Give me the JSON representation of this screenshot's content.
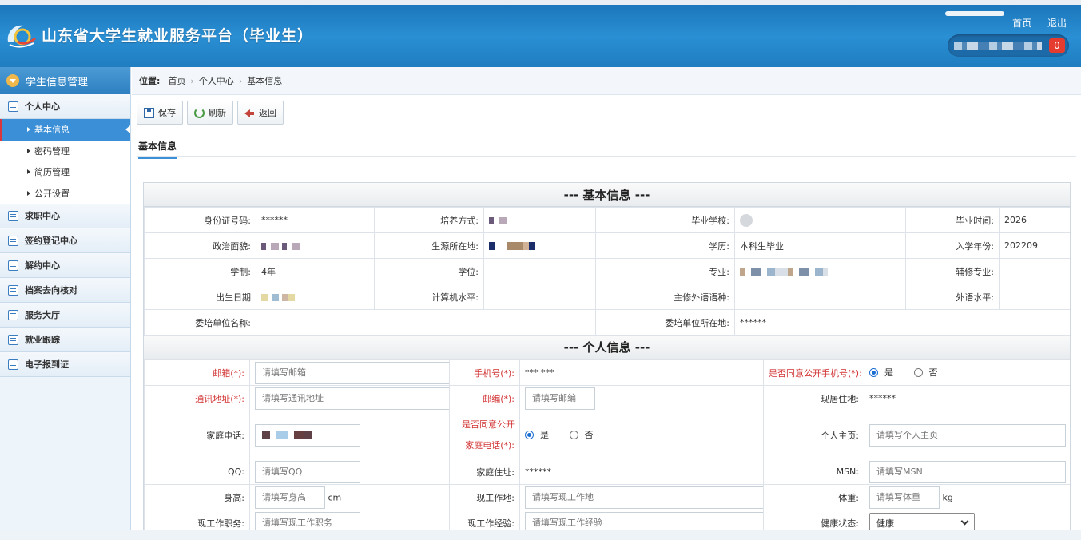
{
  "header": {
    "title": "山东省大学生就业服务平台（毕业生）",
    "home_link": "首页",
    "logout_link": "退出",
    "notification_count": "0"
  },
  "sidebar": {
    "header": "学生信息管理",
    "groups": [
      {
        "label": "个人中心"
      },
      {
        "label": "求职中心"
      },
      {
        "label": "签约登记中心"
      },
      {
        "label": "解约中心"
      },
      {
        "label": "档案去向核对"
      },
      {
        "label": "服务大厅"
      },
      {
        "label": "就业跟踪"
      },
      {
        "label": "电子报到证"
      }
    ],
    "sub_items": [
      {
        "label": "基本信息"
      },
      {
        "label": "密码管理"
      },
      {
        "label": "简历管理"
      },
      {
        "label": "公开设置"
      }
    ]
  },
  "breadcrumb": {
    "label": "位置:",
    "items": [
      "首页",
      "个人中心",
      "基本信息"
    ]
  },
  "toolbar": {
    "save": "保存",
    "refresh": "刷新",
    "back": "返回"
  },
  "tab": "基本信息",
  "basic": {
    "title": "--- 基本信息 ---",
    "id_label": "身份证号码:",
    "id_value": "******",
    "train_label": "培养方式:",
    "school_label": "毕业学校:",
    "grad_time_label": "毕业时间:",
    "grad_time_value": "2026",
    "political_label": "政治面貌:",
    "origin_label": "生源所在地:",
    "edu_label": "学历:",
    "edu_value": "本科生毕业",
    "enroll_label": "入学年份:",
    "enroll_value": "202209",
    "length_label": "学制:",
    "length_value": "4年",
    "degree_label": "学位:",
    "major_label": "专业:",
    "minor_label": "辅修专业:",
    "birth_label": "出生日期",
    "computer_label": "计算机水平:",
    "language_label": "主修外语语种:",
    "language_level_label": "外语水平:",
    "entrust_name_label": "委培单位名称:",
    "entrust_loc_label": "委培单位所在地:",
    "entrust_loc_value": "******"
  },
  "personal": {
    "title": "--- 个人信息 ---",
    "email_label": "邮箱(*):",
    "email_placeholder": "请填写邮箱",
    "phone_label": "手机号(*):",
    "phone_value": "*** ***",
    "public_phone_label": "是否同意公开手机号(*):",
    "yes": "是",
    "no": "否",
    "address_label": "通讯地址(*):",
    "address_placeholder": "请填写通讯地址",
    "zip_label": "邮编(*):",
    "zip_placeholder": "请填写邮编",
    "residence_label": "现居住地:",
    "residence_value": "******",
    "home_phone_label": "家庭电话:",
    "public_home_label_1": "是否同意公开",
    "public_home_label_2": "家庭电话(*):",
    "homepage_label": "个人主页:",
    "homepage_placeholder": "请填写个人主页",
    "qq_label": "QQ:",
    "qq_placeholder": "请填写QQ",
    "home_addr_label": "家庭住址:",
    "home_addr_value": "******",
    "msn_label": "MSN:",
    "msn_placeholder": "请填写MSN",
    "height_label": "身高:",
    "height_placeholder": "请填写身高",
    "height_unit": "cm",
    "workplace_label": "现工作地:",
    "workplace_placeholder": "请填写现工作地",
    "weight_label": "体重:",
    "weight_placeholder": "请填写体重",
    "weight_unit": "kg",
    "job_label": "现工作职务:",
    "job_placeholder": "请填写现工作职务",
    "experience_label": "现工作经验:",
    "experience_placeholder": "请填写现工作经验",
    "health_label": "健康状态:",
    "health_value": "健康"
  },
  "colors": {
    "header_blue": "#1f7dc0",
    "required_red": "#d23333",
    "active_blue": "#3a8fd6",
    "badge_red": "#e63c2f"
  }
}
